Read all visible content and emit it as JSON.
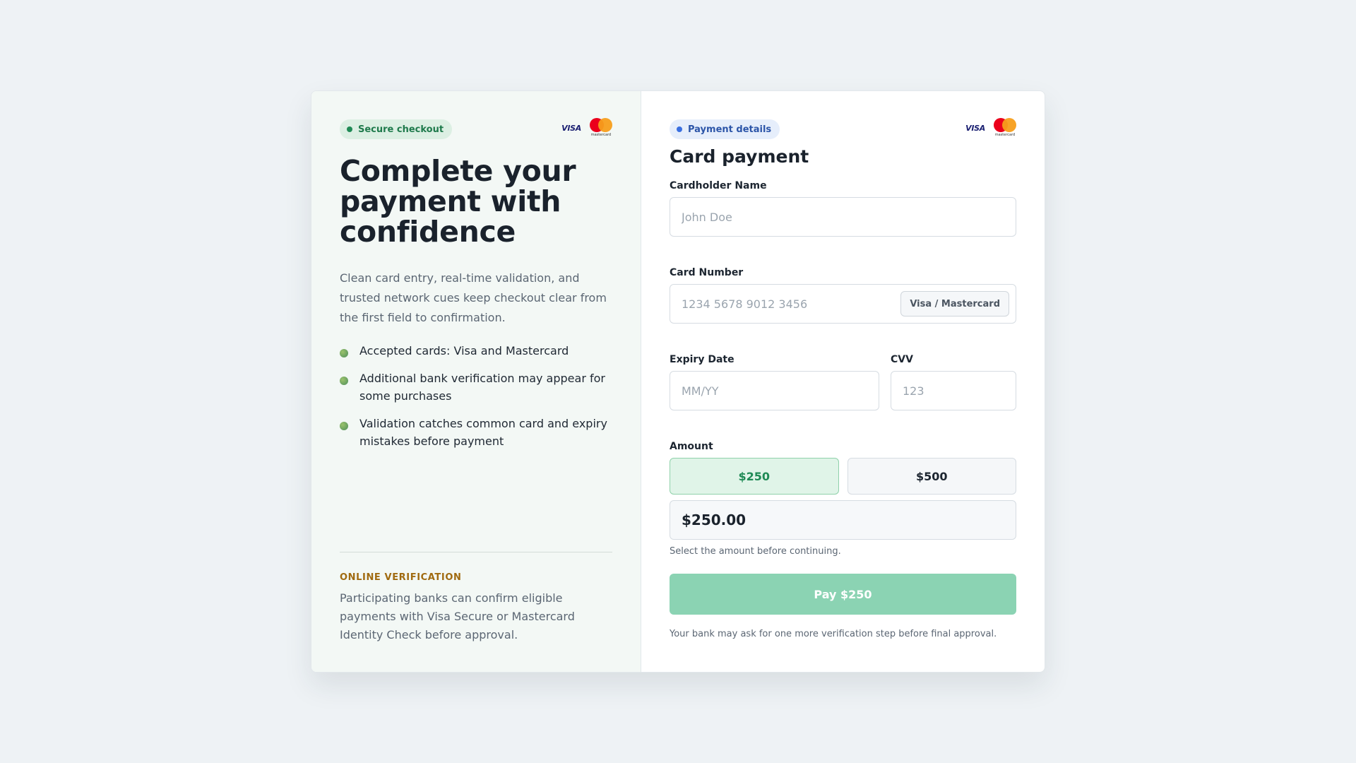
{
  "left": {
    "badge": "Secure checkout",
    "brands": {
      "visa": "VISA",
      "mastercard": "mastercard"
    },
    "headline": "Complete your payment with confidence",
    "description": "Clean card entry, real-time validation, and trusted network cues keep checkout clear from the first field to confirmation.",
    "bullets": [
      "Accepted cards: Visa and Mastercard",
      "Additional bank verification may appear for some purchases",
      "Validation catches common card and expiry mistakes before payment"
    ],
    "verification_title": "ONLINE VERIFICATION",
    "verification_text": "Participating banks can confirm eligible payments with Visa Secure or Mastercard Identity Check before approval."
  },
  "form": {
    "badge": "Payment details",
    "brands": {
      "visa": "VISA",
      "mastercard": "mastercard"
    },
    "title": "Card payment",
    "cardholder": {
      "label": "Cardholder Name",
      "placeholder": "John Doe",
      "value": ""
    },
    "card_number": {
      "label": "Card Number",
      "placeholder": "1234 5678 9012 3456",
      "value": "",
      "network_badge": "Visa / Mastercard"
    },
    "expiry": {
      "label": "Expiry Date",
      "placeholder": "MM/YY",
      "value": ""
    },
    "cvv": {
      "label": "CVV",
      "placeholder": "123",
      "value": ""
    },
    "amount": {
      "label": "Amount",
      "options": [
        "$250",
        "$500"
      ],
      "selected": "$250",
      "display": "$250.00",
      "hint": "Select the amount before continuing."
    },
    "pay_button": "Pay $250",
    "footnote": "Your bank may ask for one more verification step before final approval."
  },
  "colors": {
    "accent_green": "#1f8a55",
    "pay_button_disabled": "#8bd3b3",
    "verification_gold": "#a06a10",
    "badge_blue": "#2c55a8"
  }
}
